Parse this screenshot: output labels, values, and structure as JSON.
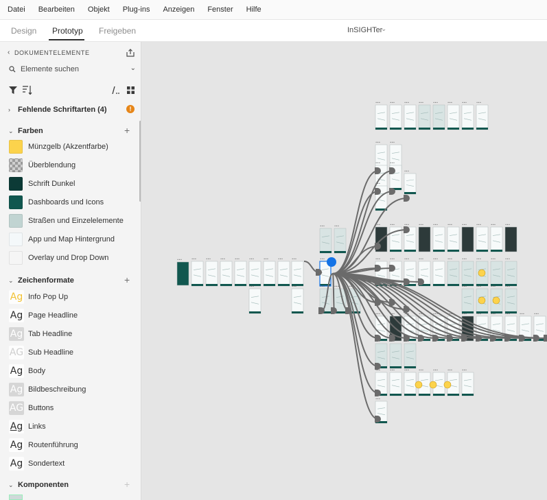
{
  "menu": [
    "Datei",
    "Bearbeiten",
    "Objekt",
    "Plug-ins",
    "Anzeigen",
    "Fenster",
    "Hilfe"
  ],
  "tabs": {
    "design": "Design",
    "prototype": "Prototyp",
    "share": "Freigeben"
  },
  "document_title": "InSIGHTer",
  "library": {
    "title": "DOKUMENTELEMENTE",
    "search_placeholder": "Elemente suchen",
    "missing_fonts": "Fehlende Schriftarten (4)",
    "colors_title": "Farben",
    "colors": [
      {
        "label": "Münzgelb (Akzentfarbe)",
        "hex": "#fcd34c"
      },
      {
        "label": "Überblendung",
        "hex": "checker"
      },
      {
        "label": "Schrift Dunkel",
        "hex": "#0c3a36"
      },
      {
        "label": "Dashboards und Icons",
        "hex": "#11574f"
      },
      {
        "label": "Straßen und Einzelelemente",
        "hex": "#c1d4d2"
      },
      {
        "label": "App und Map Hintergrund",
        "hex": "#f4f8fa"
      },
      {
        "label": "Overlay und Drop Down",
        "hex": "#f5f5f5"
      }
    ],
    "char_styles_title": "Zeichenformate",
    "char_styles": [
      {
        "label": "Info Pop Up",
        "sample": "Ag",
        "fg": "#f2c233",
        "bg": "#fdfdfd"
      },
      {
        "label": "Page Headline",
        "sample": "Ag",
        "fg": "#2c2c2c",
        "bg": "#fdfdfd"
      },
      {
        "label": "Tab Headline",
        "sample": "Ag",
        "fg": "#ffffff",
        "bg": "#d6d6d6"
      },
      {
        "label": "Sub Headline",
        "sample": "AG",
        "fg": "#cfcfcf",
        "bg": "#fdfdfd"
      },
      {
        "label": "Body",
        "sample": "Ag",
        "fg": "#2c2c2c",
        "bg": "#fdfdfd"
      },
      {
        "label": "Bildbeschreibung",
        "sample": "Ag",
        "fg": "#ffffff",
        "bg": "#d6d6d6"
      },
      {
        "label": "Buttons",
        "sample": "AG",
        "fg": "#ffffff",
        "bg": "#d6d6d6"
      },
      {
        "label": "Links",
        "sample": "Ag",
        "fg": "#2c2c2c",
        "bg": "#fdfdfd"
      },
      {
        "label": "Routenführung",
        "sample": "Ag",
        "fg": "#2c2c2c",
        "bg": "#fdfdfd"
      },
      {
        "label": "Sondertext",
        "sample": "Ag",
        "fg": "#2c2c2c",
        "bg": "#fdfdfd"
      }
    ],
    "components_title": "Komponenten"
  },
  "theme": {
    "accent": "#1473e6",
    "teal": "#11574f",
    "wire": "#6b6b6b"
  }
}
